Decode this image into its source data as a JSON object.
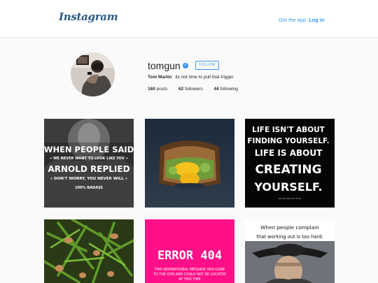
{
  "header": {
    "logo_text": "Instagram",
    "get_app_label": "Get the app",
    "login_label": "Log in"
  },
  "profile": {
    "username": "tomgun",
    "verified_mark": "✓",
    "follow_label": "FOLLOW",
    "full_name": "Tom Martin",
    "bio": "its not time to pull that trigger",
    "posts_count": "160",
    "posts_label": "posts",
    "followers_count": "62",
    "followers_label": "followers",
    "following_count": "44",
    "following_label": "following"
  },
  "posts": [
    {
      "line1": "WHEN PEOPLE SAID",
      "line2": "« WE NEVER WANT TO LOOK LIKE YOU »",
      "line3": "ARNOLD REPLIED",
      "line4": "« DON'T WORRY, YOU NEVER WILL »",
      "line5": "100% BADASS"
    },
    {
      "subject": "grilled cheese sandwich with avocado and egg"
    },
    {
      "line1": "LIFE ISN'T ABOUT",
      "line2": "FINDING YOURSELF.",
      "line3": "LIFE IS ABOUT",
      "line4": "CREATING",
      "line5": "YOURSELF.",
      "credit": "George Bernard Shaw"
    },
    {
      "subject": "green beans with mushrooms"
    },
    {
      "title": "ERROR 404",
      "line1": "THIS INSPIRATIONAL MESSAGE HAS GONE",
      "line2": "TO THE GYM AND COULD NOT BE LOCATED",
      "line3": "AT THIS TIME"
    },
    {
      "line1": "When people complain",
      "line2": "that working out is too hard:"
    }
  ],
  "colors": {
    "accent": "#3897f0",
    "logo": "#2a5a86",
    "error_pink": "#ff0f88"
  }
}
